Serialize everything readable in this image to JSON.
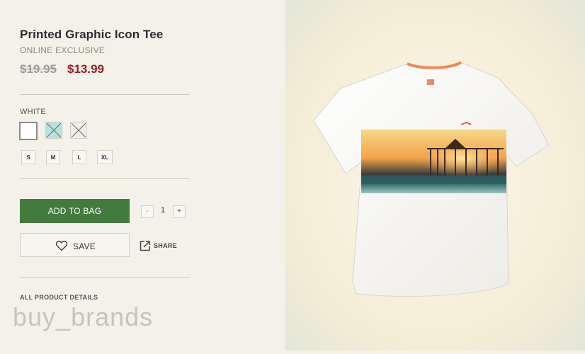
{
  "product": {
    "title": "Printed Graphic Icon Tee",
    "badge": "ONLINE EXCLUSIVE",
    "old_price": "$19.95",
    "new_price": "$13.99"
  },
  "color": {
    "selected_label": "WHITE",
    "swatches": [
      "#ffffff",
      "#b9e1de",
      "#efeee6"
    ]
  },
  "sizes": [
    "S",
    "M",
    "L",
    "XL"
  ],
  "actions": {
    "add_to_bag": "ADD TO BAG",
    "qty_minus": "-",
    "qty_value": "1",
    "qty_plus": "+",
    "save": "SAVE",
    "share": "SHARE"
  },
  "details_link": "ALL PRODUCT DETAILS",
  "watermark": "buy_brands",
  "icons": {
    "save": "heart-icon",
    "share": "share-icon"
  }
}
